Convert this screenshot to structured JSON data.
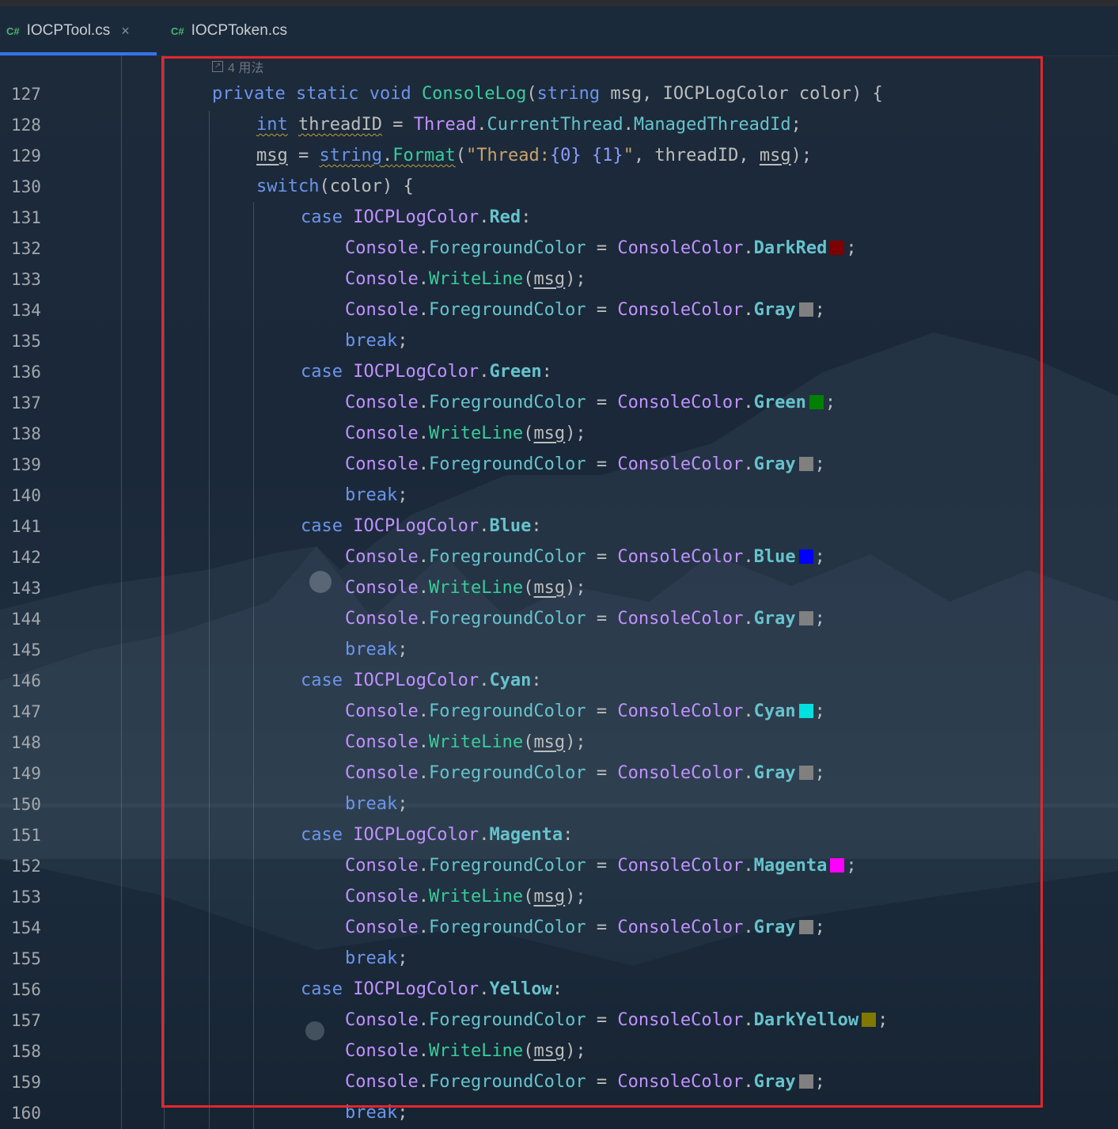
{
  "tabs": [
    {
      "lang": "C#",
      "name": "IOCPTool.cs",
      "close": "×",
      "active": true
    },
    {
      "lang": "C#",
      "name": "IOCPToken.cs",
      "active": false
    }
  ],
  "editor": {
    "usage_hint": "4 用法",
    "line_numbers": [
      "127",
      "128",
      "129",
      "130",
      "131",
      "132",
      "133",
      "134",
      "135",
      "136",
      "137",
      "138",
      "139",
      "140",
      "141",
      "142",
      "143",
      "144",
      "145",
      "146",
      "147",
      "148",
      "149",
      "150",
      "151",
      "152",
      "153",
      "154",
      "155",
      "156",
      "157",
      "158",
      "159",
      "160"
    ],
    "tokens": {
      "private": "private",
      "static": "static",
      "void": "void",
      "ConsoleLog": "ConsoleLog",
      "string": "string",
      "msg": "msg",
      "IOCPLogColor": "IOCPLogColor",
      "color": "color",
      "int": "int",
      "threadID": "threadID",
      "Thread": "Thread",
      "CurrentThread": "CurrentThread",
      "ManagedThreadId": "ManagedThreadId",
      "Format": "Format",
      "str_start": "\"Thread:",
      "str_mid": " ",
      "str_end": "\"",
      "arg0": "{0}",
      "arg1": "{1}",
      "switch": "switch",
      "case": "case",
      "break": "break",
      "Console": "Console",
      "ForegroundColor": "ForegroundColor",
      "WriteLine": "WriteLine",
      "ConsoleColor": "ConsoleColor",
      "Red": "Red",
      "Green": "Green",
      "Blue": "Blue",
      "Cyan": "Cyan",
      "Magenta": "Magenta",
      "Yellow": "Yellow",
      "DarkRed": "DarkRed",
      "Gray": "Gray",
      "DarkYellow": "DarkYellow"
    },
    "swatches": {
      "DarkRed": "#7f0000",
      "Gray": "#808080",
      "Green": "#008000",
      "Blue": "#0000ff",
      "Cyan": "#00e0e0",
      "Magenta": "#ff00ff",
      "DarkYellow": "#807800"
    }
  },
  "highlight_box_color": "#e5262c"
}
